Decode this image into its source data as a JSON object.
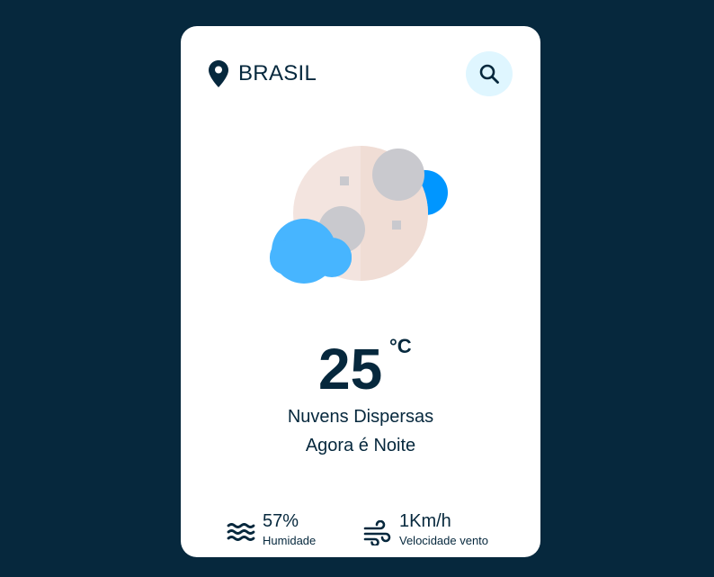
{
  "header": {
    "location": "BRASIL",
    "location_icon": "map-pin-icon",
    "search_icon": "search-icon"
  },
  "weather": {
    "icon": "moon-with-clouds-icon",
    "temperature": "25",
    "unit": "°C",
    "description": "Nuvens Dispersas",
    "time_of_day": "Agora é Noite"
  },
  "details": {
    "humidity": {
      "value": "57%",
      "label": "Humidade",
      "icon": "waves-icon"
    },
    "wind": {
      "value": "1Km/h",
      "label": "Velocidade vento",
      "icon": "wind-icon"
    }
  },
  "colors": {
    "background": "#06283d",
    "card": "#ffffff",
    "text": "#06283d",
    "search_bg": "#dff6ff",
    "cloud_light": "#47b5ff",
    "cloud_dark": "#0096ff",
    "moon": "#f3e4df"
  }
}
